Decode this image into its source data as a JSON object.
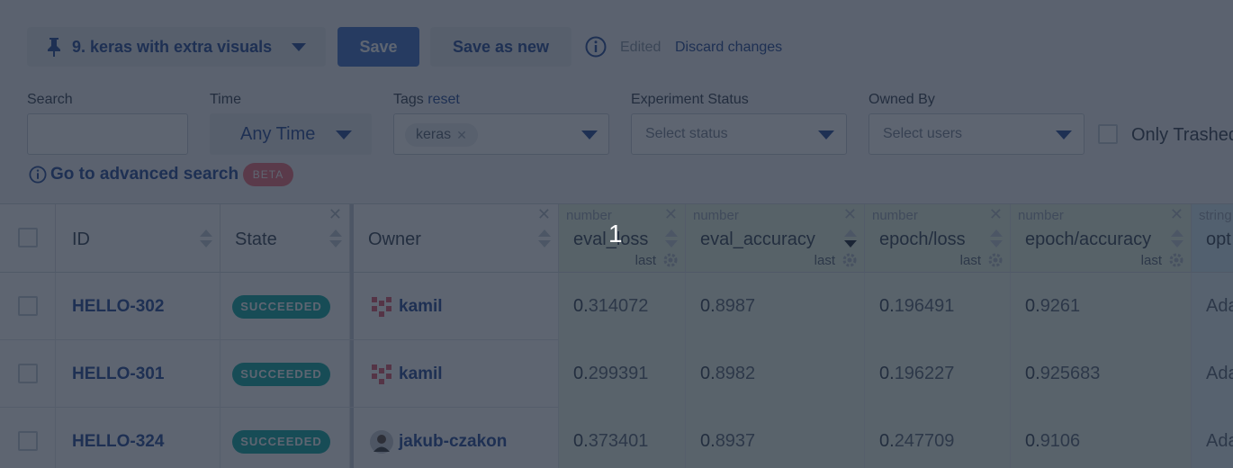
{
  "toolbar": {
    "view_label": "9. keras with extra visuals",
    "save_label": "Save",
    "save_as_new_label": "Save as new",
    "edited_text": "Edited",
    "discard_label": "Discard changes"
  },
  "filters": {
    "search_label": "Search",
    "search_value": "",
    "time_label": "Time",
    "time_value": "Any Time",
    "tags_label": "Tags",
    "tags_reset": "reset",
    "tags": [
      "keras"
    ],
    "status_label": "Experiment Status",
    "status_placeholder": "Select status",
    "owned_label": "Owned By",
    "owned_placeholder": "Select users",
    "only_trashed_label": "Only Trashed",
    "advanced_search_label": "Go to advanced search",
    "beta_label": "BETA"
  },
  "table": {
    "columns": {
      "id": "ID",
      "state": "State",
      "owner": "Owner",
      "eval_loss": {
        "type": "number",
        "title": "eval_loss",
        "agg": "last"
      },
      "eval_accuracy": {
        "type": "number",
        "title": "eval_accuracy",
        "agg": "last"
      },
      "epoch_loss": {
        "type": "number",
        "title": "epoch/loss",
        "agg": "last"
      },
      "epoch_accuracy": {
        "type": "number",
        "title": "epoch/accuracy",
        "agg": "last"
      },
      "optimizer": {
        "type": "string",
        "title": "opt"
      }
    },
    "rows": [
      {
        "id": "HELLO-302",
        "state": "SUCCEEDED",
        "owner": "kamil",
        "eval_loss_int": "0.",
        "eval_loss_frac": "314072",
        "eval_acc_int": "0.",
        "eval_acc_frac": "8987",
        "epoch_loss_int": "0.",
        "epoch_loss_frac": "196491",
        "epoch_acc_int": "0.",
        "epoch_acc_frac": "9261",
        "optimizer": "Ada"
      },
      {
        "id": "HELLO-301",
        "state": "SUCCEEDED",
        "owner": "kamil",
        "eval_loss_int": "0.",
        "eval_loss_frac": "299391",
        "eval_acc_int": "0.",
        "eval_acc_frac": "8982",
        "epoch_loss_int": "0.",
        "epoch_loss_frac": "196227",
        "epoch_acc_int": "0.",
        "epoch_acc_frac": "925683",
        "optimizer": "Ada"
      },
      {
        "id": "HELLO-324",
        "state": "SUCCEEDED",
        "owner": "jakub-czakon",
        "eval_loss_int": "0.",
        "eval_loss_frac": "373401",
        "eval_acc_int": "0.",
        "eval_acc_frac": "8937",
        "epoch_loss_int": "0.",
        "epoch_loss_frac": "247709",
        "epoch_acc_int": "0.",
        "epoch_acc_frac": "9106",
        "optimizer": "Ada"
      }
    ]
  },
  "step_marker": "1",
  "colors": {
    "accent": "#2a4d9a",
    "primary_button": "#4474c8",
    "status_succeeded": "#13aba6",
    "beta_badge": "#f1717c",
    "numeric_column_bg": "#e6f5e1",
    "string_column_bg": "#d7eef7"
  },
  "icons": [
    "pin-icon",
    "chevron-down-icon",
    "info-icon",
    "close-icon",
    "sort-icon",
    "gear-icon",
    "avatar"
  ]
}
